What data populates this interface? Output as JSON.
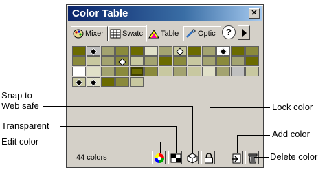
{
  "window": {
    "title": "Color Table",
    "close_label": "✕"
  },
  "tabs": [
    {
      "label": "Mixer",
      "icon": "mixer-icon"
    },
    {
      "label": "Swatc",
      "icon": "swatches-icon"
    },
    {
      "label": "Table",
      "icon": "table-icon"
    },
    {
      "label": "Optic",
      "icon": "options-icon"
    }
  ],
  "help_label": "?",
  "status": {
    "count": "44 colors"
  },
  "callouts": {
    "snap": "Snap to\nWeb safe",
    "transparent": "Transparent",
    "edit": "Edit color",
    "lock": "Lock color",
    "add": "Add color",
    "delete": "Delete color"
  },
  "colors": {
    "dark_olive": "#6b6b00",
    "olive": "#8a8a3c",
    "sage": "#a3a370",
    "light": "#c8c8a0",
    "pale": "#e0e0c8",
    "grey": "#c0c0c0",
    "white": "#ffffff"
  },
  "swatch_rows": [
    [
      "dark_olive",
      "grey",
      "sage",
      "olive",
      "dark_olive",
      "pale",
      "sage",
      "light",
      "dark_olive",
      "sage",
      "white",
      "dark_olive",
      "olive"
    ],
    [
      "olive",
      "light",
      "sage",
      "olive",
      "light",
      "sage",
      "dark_olive",
      "olive",
      "light",
      "sage",
      "olive",
      "sage",
      "dark_olive"
    ],
    [
      "white",
      "pale",
      "sage",
      "olive",
      "dark_olive",
      "olive",
      "light",
      "sage",
      "light",
      "pale",
      "sage",
      "grey",
      "light"
    ],
    [
      "light",
      "pale",
      "dark_olive",
      "olive",
      "light"
    ]
  ]
}
